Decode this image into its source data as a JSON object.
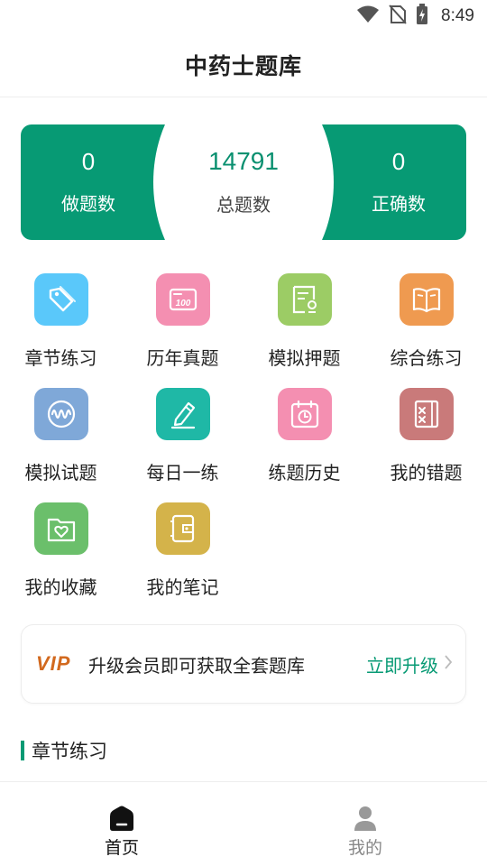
{
  "status_bar": {
    "time": "8:49"
  },
  "header": {
    "title": "中药士题库"
  },
  "stats": [
    {
      "value": "0",
      "label": "做题数"
    },
    {
      "value": "14791",
      "label": "总题数"
    },
    {
      "value": "0",
      "label": "正确数"
    }
  ],
  "menu": [
    {
      "label": "章节练习",
      "icon": "tag-icon",
      "color": "#5ac8fa"
    },
    {
      "label": "历年真题",
      "icon": "score-100-icon",
      "color": "#f48fb1"
    },
    {
      "label": "模拟押题",
      "icon": "certificate-icon",
      "color": "#9ccc65"
    },
    {
      "label": "综合练习",
      "icon": "open-book-icon",
      "color": "#ef9a50"
    },
    {
      "label": "模拟试题",
      "icon": "wave-circle-icon",
      "color": "#7fa8d8"
    },
    {
      "label": "每日一练",
      "icon": "pencil-icon",
      "color": "#1fb8a6"
    },
    {
      "label": "练题历史",
      "icon": "calendar-history-icon",
      "color": "#f48fb1"
    },
    {
      "label": "我的错题",
      "icon": "wrong-notebook-icon",
      "color": "#c97a7a"
    },
    {
      "label": "我的收藏",
      "icon": "heart-folder-icon",
      "color": "#6bbf6b"
    },
    {
      "label": "我的笔记",
      "icon": "wallet-note-icon",
      "color": "#d4b34a"
    }
  ],
  "vip": {
    "badge": "VIP",
    "text": "升级会员即可获取全套题库",
    "link": "立即升级"
  },
  "section": {
    "title": "章节练习"
  },
  "tabs": [
    {
      "label": "首页"
    },
    {
      "label": "我的"
    }
  ]
}
